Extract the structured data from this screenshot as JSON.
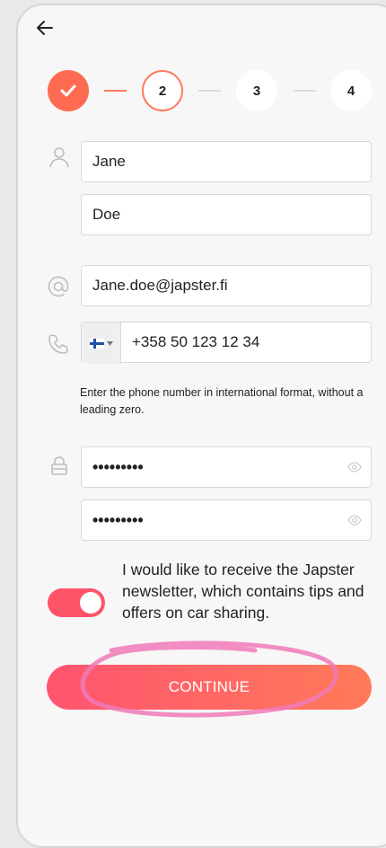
{
  "stepper": {
    "steps": [
      {
        "label": "",
        "state": "done"
      },
      {
        "label": "2",
        "state": "active"
      },
      {
        "label": "3",
        "state": "todo"
      },
      {
        "label": "4",
        "state": "todo"
      }
    ]
  },
  "form": {
    "first_name": "Jane",
    "last_name": "Doe",
    "email": "Jane.doe@japster.fi",
    "phone": "+358 50 123 12 34",
    "phone_hint": "Enter the phone number in international format, without a leading zero.",
    "password": "•••••••••",
    "password_confirm": "•••••••••"
  },
  "newsletter": {
    "label": "I would like to receive the Japster newsletter, which contains tips and offers on car sharing.",
    "enabled": true
  },
  "actions": {
    "continue_label": "CONTINUE"
  },
  "colors": {
    "accent": "#ff6b52",
    "toggle": "#ff5468",
    "annotation": "#f07ab8"
  },
  "icons": {
    "back": "arrow-left-icon",
    "name": "user-icon",
    "email": "at-icon",
    "phone": "phone-icon",
    "password": "lock-icon",
    "reveal": "eye-icon",
    "flag": "finland-flag-icon"
  }
}
